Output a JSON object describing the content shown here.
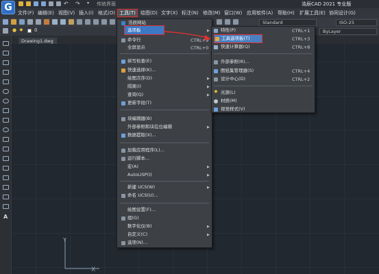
{
  "app": {
    "logo_letter": "G",
    "title": "浩辰CAD 2021 专业版",
    "workspace": "传统界面"
  },
  "menubar": {
    "items": [
      {
        "label": "文件(F)"
      },
      {
        "label": "编辑(E)"
      },
      {
        "label": "视图(V)"
      },
      {
        "label": "插入(I)"
      },
      {
        "label": "格式(O)"
      },
      {
        "label": "工具(T)"
      },
      {
        "label": "绘图(D)"
      },
      {
        "label": "文字(X)"
      },
      {
        "label": "标注(N)"
      },
      {
        "label": "修改(M)"
      },
      {
        "label": "窗口(W)"
      },
      {
        "label": "应用软件(A)"
      },
      {
        "label": "帮助(H)"
      },
      {
        "label": "扩展工具(E)"
      },
      {
        "label": "协同设计(G)"
      }
    ]
  },
  "toolbar": {
    "textstyle": "Standard",
    "dimstyle": "ISO-25",
    "layer_value": "0",
    "linetype": "ByLayer"
  },
  "tabs": {
    "drawing": "Drawing1.dwg"
  },
  "tools_menu": {
    "items": [
      {
        "label": "浩辰网站",
        "shortcut": "",
        "arrow": false
      },
      {
        "label": "选项板",
        "shortcut": "",
        "arrow": true
      },
      {
        "label": "命令行",
        "shortcut": "CTRL+9",
        "arrow": false
      },
      {
        "label": "全屏显示",
        "shortcut": "CTRL+0",
        "arrow": false
      },
      {
        "label": "拼写检查(E)",
        "shortcut": "",
        "arrow": false
      },
      {
        "label": "快速选择(K)...",
        "shortcut": "",
        "arrow": false
      },
      {
        "label": "绘图次序(D)",
        "shortcut": "",
        "arrow": true
      },
      {
        "label": "隔离(I)",
        "shortcut": "",
        "arrow": true
      },
      {
        "label": "查询(Q)",
        "shortcut": "",
        "arrow": true
      },
      {
        "label": "更新字段(T)",
        "shortcut": "",
        "arrow": false
      },
      {
        "label": "块编辑器(B)",
        "shortcut": "",
        "arrow": false
      },
      {
        "label": "外部参照和块在位编辑",
        "shortcut": "",
        "arrow": true
      },
      {
        "label": "数据提取(X)...",
        "shortcut": "",
        "arrow": false
      },
      {
        "label": "加载应用程序(L)...",
        "shortcut": "",
        "arrow": false
      },
      {
        "label": "运行脚本...",
        "shortcut": "",
        "arrow": false
      },
      {
        "label": "宏(A)",
        "shortcut": "",
        "arrow": true
      },
      {
        "label": "AutoLISP(I)",
        "shortcut": "",
        "arrow": true
      },
      {
        "label": "新建 UCS(W)",
        "shortcut": "",
        "arrow": true
      },
      {
        "label": "命名 UCS(U)...",
        "shortcut": "",
        "arrow": false
      },
      {
        "label": "绘图设置(F)...",
        "shortcut": "",
        "arrow": false
      },
      {
        "label": "组(G)",
        "shortcut": "",
        "arrow": false
      },
      {
        "label": "数字化仪(B)",
        "shortcut": "",
        "arrow": true
      },
      {
        "label": "自定义(C)",
        "shortcut": "",
        "arrow": true
      },
      {
        "label": "选项(N)...",
        "shortcut": "",
        "arrow": false
      }
    ]
  },
  "options_submenu": {
    "items": [
      {
        "label": "特性(P)",
        "shortcut": "CTRL+1"
      },
      {
        "label": "工具选项板(T)",
        "shortcut": "CTRL+3"
      },
      {
        "label": "快速计算器(Q)",
        "shortcut": "CTRL+8"
      },
      {
        "label": "外部参照(R)...",
        "shortcut": ""
      },
      {
        "label": "图纸集管理器(S)",
        "shortcut": "CTRL+4"
      },
      {
        "label": "设计中心(D)",
        "shortcut": "CTRL+2"
      },
      {
        "label": "光源(L)",
        "shortcut": ""
      },
      {
        "label": "材质(M)",
        "shortcut": ""
      },
      {
        "label": "视觉样式(V)",
        "shortcut": ""
      }
    ]
  },
  "colors": {
    "highlight": "#3c78c4",
    "annotation_red": "#e03030",
    "canvas_bg": "#212830"
  }
}
